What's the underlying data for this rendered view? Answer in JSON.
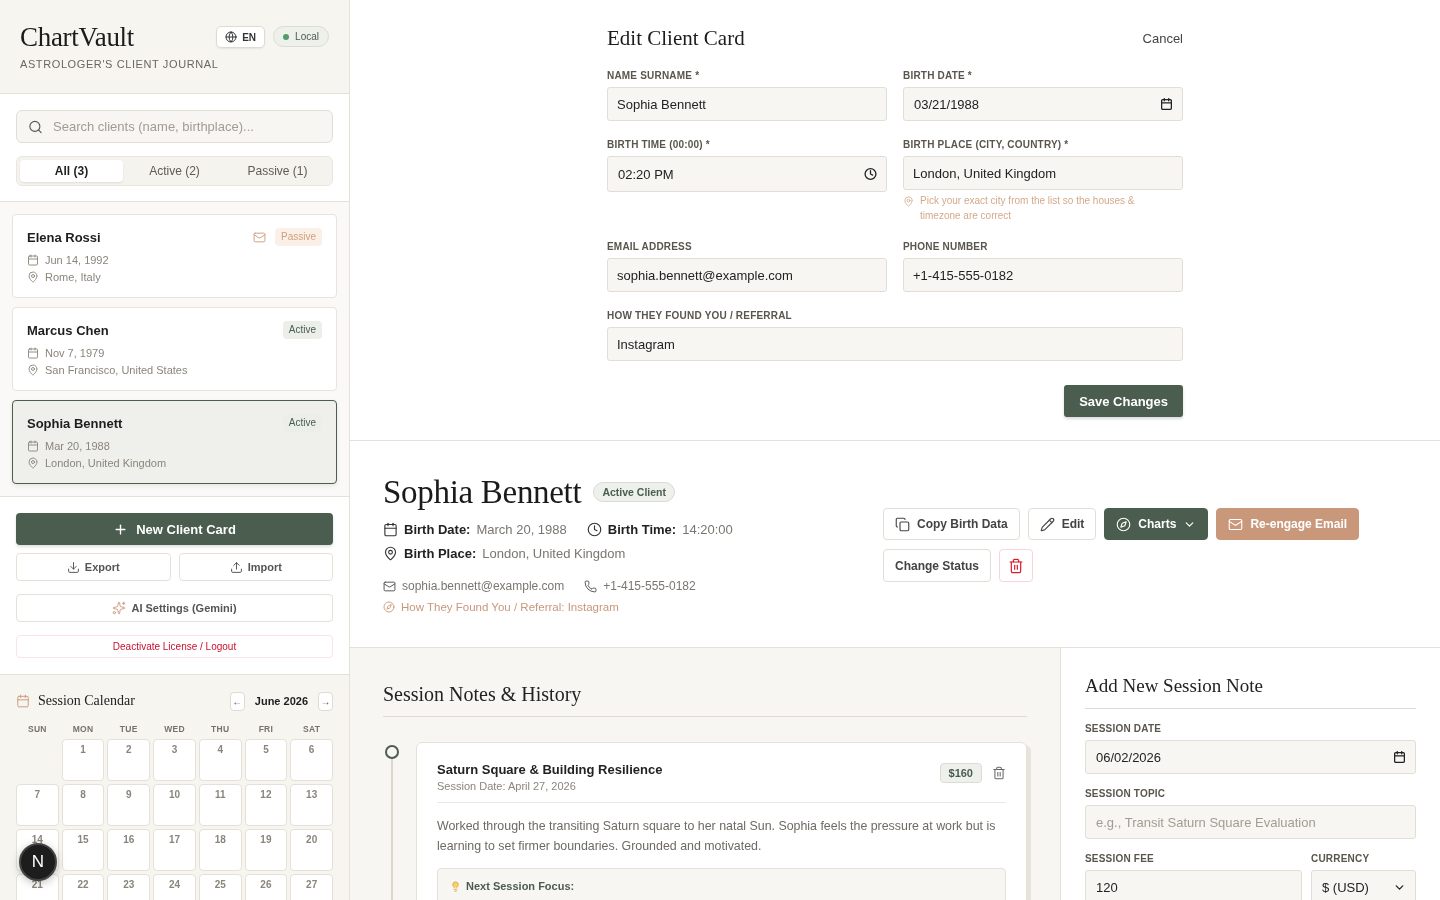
{
  "sidebar": {
    "brand": {
      "title": "ChartVault",
      "subtitle": "ASTROLOGER'S CLIENT JOURNAL"
    },
    "language_button": {
      "label": "EN"
    },
    "storage_badge": {
      "label": "Local"
    },
    "search": {
      "placeholder": "Search clients (name, birthplace)..."
    },
    "filter_tabs": [
      {
        "label": "All (3)",
        "selected": true
      },
      {
        "label": "Active (2)",
        "selected": false
      },
      {
        "label": "Passive (1)",
        "selected": false
      }
    ],
    "clients": [
      {
        "name": "Elena Rossi",
        "birth_date": "Jun 14, 1992",
        "birth_place": "Rome, Italy",
        "status": {
          "label": "Passive",
          "kind": "passive"
        },
        "email_flag": true,
        "selected": false
      },
      {
        "name": "Marcus Chen",
        "birth_date": "Nov 7, 1979",
        "birth_place": "San Francisco, United States",
        "status": {
          "label": "Active",
          "kind": "active"
        },
        "email_flag": false,
        "selected": false
      },
      {
        "name": "Sophia Bennett",
        "birth_date": "Mar 20, 1988",
        "birth_place": "London, United Kingdom",
        "status": {
          "label": "Active",
          "kind": "active"
        },
        "email_flag": false,
        "selected": true
      }
    ],
    "actions": {
      "new_client": "New Client Card",
      "export": "Export",
      "import": "Import",
      "ai_settings": "AI Settings (Gemini)",
      "logout": "Deactivate License / Logout"
    },
    "calendar": {
      "title": "Session Calendar",
      "prev": "←",
      "month": "June 2026",
      "next": "→",
      "weekdays": [
        "SUN",
        "MON",
        "TUE",
        "WED",
        "THU",
        "FRI",
        "SAT"
      ],
      "weeks": [
        [
          {
            "kind": "blank"
          },
          {
            "kind": "day",
            "day": "1"
          },
          {
            "kind": "day",
            "day": "2"
          },
          {
            "kind": "day",
            "day": "3"
          },
          {
            "kind": "day",
            "day": "4"
          },
          {
            "kind": "day",
            "day": "5"
          },
          {
            "kind": "day",
            "day": "6"
          }
        ],
        [
          {
            "kind": "day",
            "day": "7"
          },
          {
            "kind": "day",
            "day": "8"
          },
          {
            "kind": "day",
            "day": "9"
          },
          {
            "kind": "day",
            "day": "10"
          },
          {
            "kind": "day",
            "day": "11"
          },
          {
            "kind": "day",
            "day": "12"
          },
          {
            "kind": "day",
            "day": "13"
          }
        ],
        [
          {
            "kind": "day",
            "day": "14"
          },
          {
            "kind": "day",
            "day": "15"
          },
          {
            "kind": "day",
            "day": "16"
          },
          {
            "kind": "day",
            "day": "17"
          },
          {
            "kind": "day",
            "day": "18"
          },
          {
            "kind": "day",
            "day": "19"
          },
          {
            "kind": "day",
            "day": "20"
          }
        ],
        [
          {
            "kind": "day",
            "day": "21"
          },
          {
            "kind": "day",
            "day": "22"
          },
          {
            "kind": "day",
            "day": "23"
          },
          {
            "kind": "day",
            "day": "24"
          },
          {
            "kind": "day",
            "day": "25"
          },
          {
            "kind": "day",
            "day": "26"
          },
          {
            "kind": "day",
            "day": "27"
          }
        ]
      ]
    }
  },
  "dev_indicator": {
    "label": "N"
  },
  "edit_form": {
    "title": "Edit Client Card",
    "cancel": "Cancel",
    "fields": [
      {
        "label": "NAME SURNAME *",
        "value": "Sophia Bennett",
        "kind": "text",
        "full_width": false
      },
      {
        "label": "BIRTH DATE *",
        "value": "03/21/1988",
        "kind": "date",
        "full_width": false
      },
      {
        "label": "BIRTH TIME (00:00) *",
        "value": "02:20 PM",
        "kind": "time",
        "full_width": false
      },
      {
        "label": "BIRTH PLACE (CITY, COUNTRY) *",
        "value": "London, United Kingdom",
        "kind": "text",
        "full_width": false,
        "hint": "Pick your exact city from the list so the houses & timezone are correct"
      },
      {
        "label": "EMAIL ADDRESS",
        "value": "sophia.bennett@example.com",
        "kind": "text",
        "full_width": false
      },
      {
        "label": "PHONE NUMBER",
        "value": "+1-415-555-0182",
        "kind": "text",
        "full_width": false
      },
      {
        "label": "HOW THEY FOUND YOU / REFERRAL",
        "value": "Instagram",
        "kind": "text",
        "full_width": true
      }
    ],
    "submit": "Save Changes"
  },
  "profile": {
    "name": "Sophia Bennett",
    "status_badge": "Active Client",
    "birth_date": {
      "label": "Birth Date:",
      "value": "March 20, 1988"
    },
    "birth_time": {
      "label": "Birth Time:",
      "value": "14:20:00"
    },
    "birth_place": {
      "label": "Birth Place:",
      "value": "London, United Kingdom"
    },
    "email": "sophia.bennett@example.com",
    "phone": "+1-415-555-0182",
    "referral": "How They Found You / Referral: Instagram",
    "actions": [
      {
        "kind": "copy",
        "label": "Copy Birth Data"
      },
      {
        "kind": "edit",
        "label": "Edit"
      },
      {
        "kind": "charts",
        "label": "Charts"
      },
      {
        "kind": "email",
        "label": "Re-engage Email"
      },
      {
        "kind": "status",
        "label": "Change Status"
      },
      {
        "kind": "delete"
      }
    ]
  },
  "session_notes": {
    "title": "Session Notes & History",
    "entries": [
      {
        "topic": "Saturn Square & Building Resilience",
        "date": "Session Date: April 27, 2026",
        "fee": "$160",
        "body": "Worked through the transiting Saturn square to her natal Sun. Sophia feels the pressure at work but is learning to set firmer boundaries. Grounded and motivated.",
        "focus_label": "Next Session Focus:"
      }
    ]
  },
  "new_note_form": {
    "title": "Add New Session Note",
    "fields": [
      {
        "label": "SESSION DATE",
        "value": "06/02/2026",
        "kind": "date"
      },
      {
        "label": "SESSION TOPIC",
        "placeholder": "e.g., Transit Saturn Square Evaluation",
        "kind": "text"
      }
    ],
    "fee": {
      "label": "SESSION FEE",
      "value": "120"
    },
    "currency": {
      "label": "CURRENCY",
      "value": "$ (USD)"
    }
  }
}
